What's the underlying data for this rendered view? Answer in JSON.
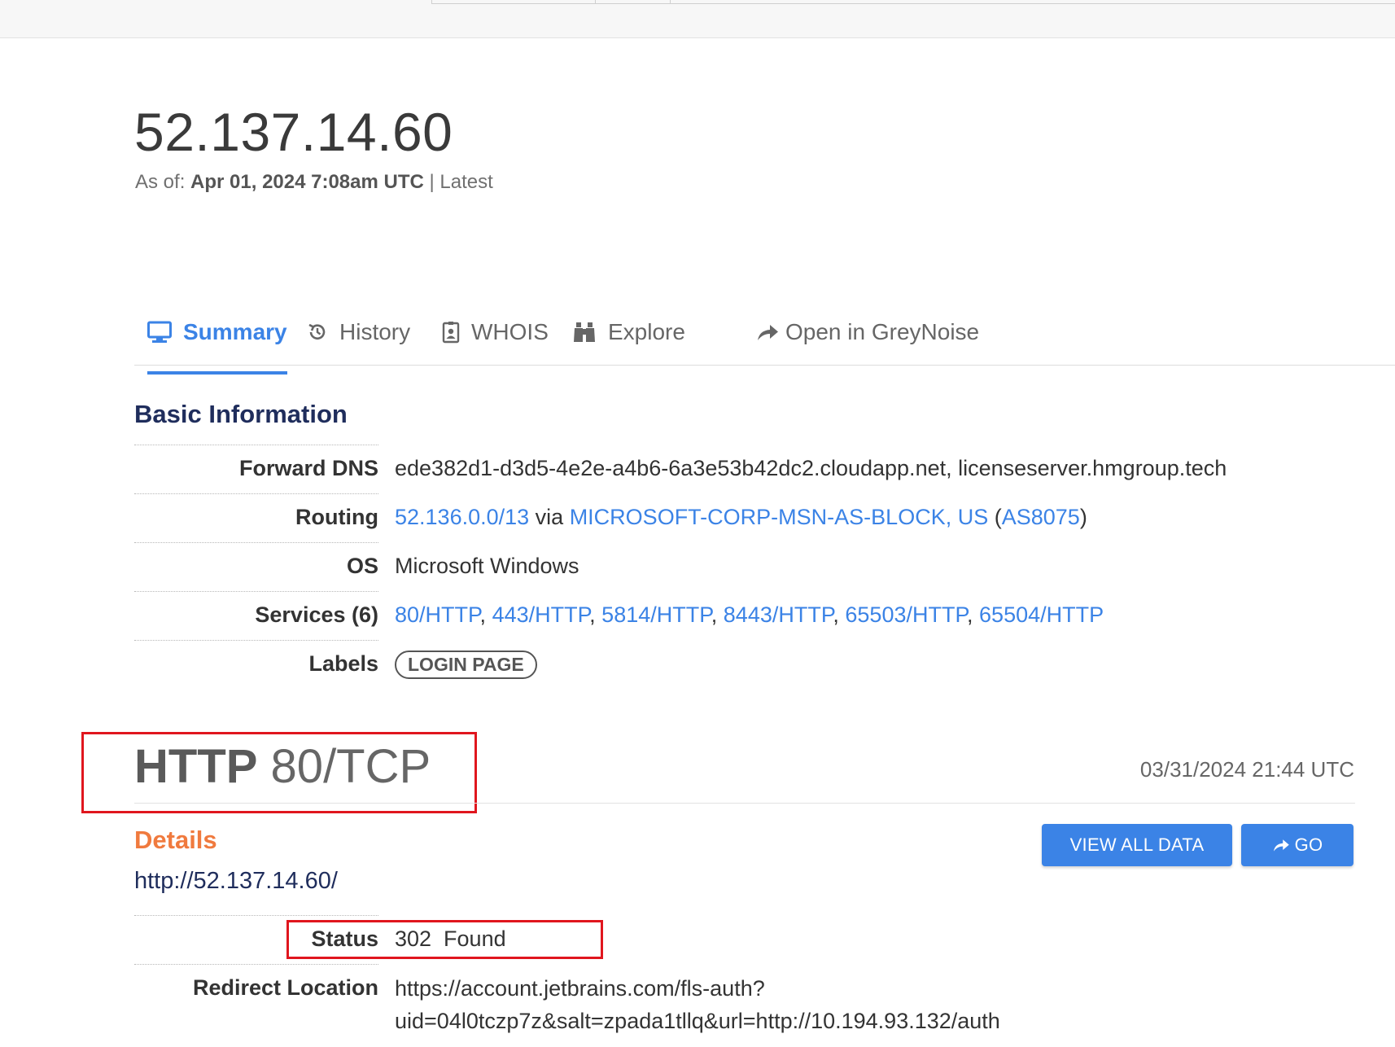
{
  "page": {
    "ip_title": "52.137.14.60",
    "asof_prefix": "As of: ",
    "asof_date": "Apr 01, 2024 7:08am UTC",
    "asof_suffix": " | Latest"
  },
  "tabs": [
    {
      "label": "Summary",
      "icon": "monitor-icon",
      "active": true
    },
    {
      "label": "History",
      "icon": "history-icon",
      "active": false
    },
    {
      "label": "WHOIS",
      "icon": "contact-card-icon",
      "active": false
    },
    {
      "label": "Explore",
      "icon": "binoculars-icon",
      "active": false
    },
    {
      "label": "Open in GreyNoise",
      "icon": "share-arrow-icon",
      "active": false
    }
  ],
  "basic": {
    "title": "Basic Information",
    "forward_dns_label": "Forward DNS",
    "forward_dns_value": "ede382d1-d3d5-4e2e-a4b6-6a3e53b42dc2.cloudapp.net, licenseserver.hmgroup.tech",
    "routing_label": "Routing",
    "routing_prefix": "52.136.0.0/13",
    "routing_via": " via ",
    "routing_as_name": "MICROSOFT-CORP-MSN-AS-BLOCK, US",
    "routing_open": " (",
    "routing_asn": "AS8075",
    "routing_close": ")",
    "os_label": "OS",
    "os_value": "Microsoft Windows",
    "services_label": "Services (6)",
    "services": [
      "80/HTTP",
      "443/HTTP",
      "5814/HTTP",
      "8443/HTTP",
      "65503/HTTP",
      "65504/HTTP"
    ],
    "services_separator": ",",
    "labels_label": "Labels",
    "label_tag": "LOGIN PAGE"
  },
  "http": {
    "proto": "HTTP",
    "port": " 80/TCP",
    "timestamp": "03/31/2024 21:44 UTC",
    "details_title": "Details",
    "view_all_label": "VIEW ALL DATA",
    "go_label": "GO",
    "url": "http://52.137.14.60/",
    "status_label": "Status",
    "status_value": "302  Found",
    "redirect_label": "Redirect Location",
    "redirect_line1": "https://account.jetbrains.com/fls-auth?",
    "redirect_line2": "uid=04l0tczp7z&salt=zpada1tllq&url=http://10.194.93.132/auth"
  },
  "colors": {
    "accent": "#3b83e6",
    "heading": "#1f2d5c",
    "details": "#f07a3e",
    "highlight_box": "#e0161e"
  }
}
